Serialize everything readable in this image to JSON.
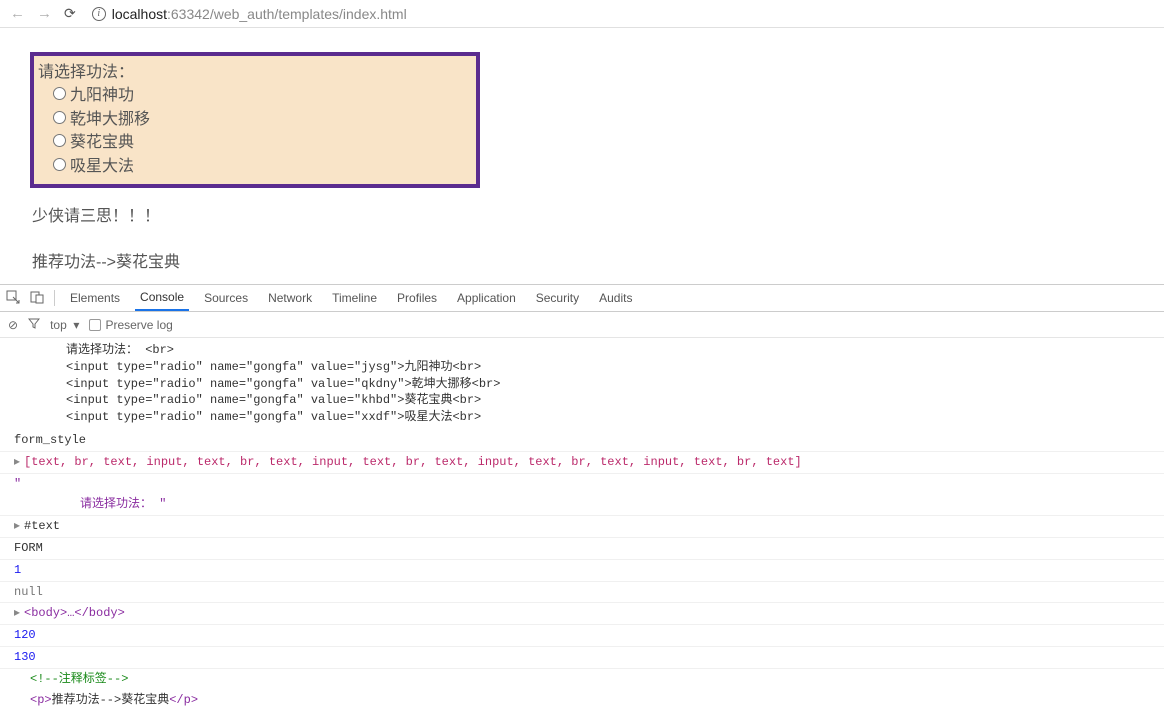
{
  "browser": {
    "host": "localhost",
    "rest": ":63342/web_auth/templates/index.html"
  },
  "gongfa": {
    "prompt": "请选择功法：",
    "opts": [
      "九阳神功",
      "乾坤大挪移",
      "葵花宝典",
      "吸星大法"
    ]
  },
  "warn": "少侠请三思！！！",
  "recommend": "推荐功法-->葵花宝典",
  "dev": {
    "tabs": {
      "elements": "Elements",
      "console": "Console",
      "sources": "Sources",
      "network": "Network",
      "timeline": "Timeline",
      "profiles": "Profiles",
      "application": "Application",
      "security": "Security",
      "audits": "Audits"
    },
    "filter": {
      "top": "top",
      "preserve": "Preserve log"
    },
    "out": {
      "line1": "请选择功法： <br>",
      "line2": "<input type=\"radio\" name=\"gongfa\" value=\"jysg\">九阳神功<br>",
      "line3": "<input type=\"radio\" name=\"gongfa\" value=\"qkdny\">乾坤大挪移<br>",
      "line4": "<input type=\"radio\" name=\"gongfa\" value=\"khbd\">葵花宝典<br>",
      "line5": "<input type=\"radio\" name=\"gongfa\" value=\"xxdf\">吸星大法<br>"
    },
    "formstyle": "form_style",
    "array": "[text, br, text, input, text, br, text, input, text, br, text, input, text, br, text, input, text, br, text]",
    "quote1": "\"",
    "quote2": "          请选择功法： \"",
    "textnode": "#text",
    "form": "FORM",
    "one": "1",
    "null": "null",
    "body": "<body>…</body>",
    "n120": "120",
    "n130": "130",
    "comment": "<!--注释标签-->",
    "rec_open": "<p>",
    "rec_text": "推荐功法-->葵花宝典",
    "rec_close": "</p>"
  }
}
